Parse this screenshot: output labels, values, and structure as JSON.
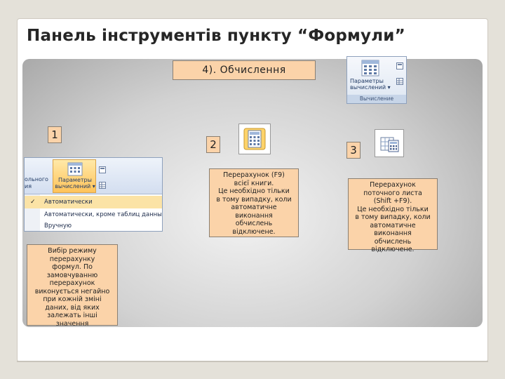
{
  "slide": {
    "title": "Панель інструментів пункту “Формули”",
    "subtitle": "4). Обчислення",
    "numbers": [
      "1",
      "2",
      "3"
    ]
  },
  "calc_group": {
    "button_label_1": "Параметры",
    "button_label_2": "вычислений",
    "group_name": "Вычисление"
  },
  "options_menu": {
    "ribbon_left_1": "ольного",
    "ribbon_left_2": "ия",
    "button_label_1": "Параметры",
    "button_label_2": "вычислений",
    "items": [
      {
        "label": "Автоматически",
        "checked": true
      },
      {
        "label": "Автоматически, кроме таблиц данных",
        "checked": false
      },
      {
        "label": "Вручную",
        "checked": false
      }
    ]
  },
  "notes": {
    "note1": "Вибір режиму\nперерахунку\nформул. По\nзамовчуванню\nперерахунок\nвиконується негайно\nпри кожній зміні\nданих, від яких\nзалежать інші\nзначення",
    "note2": "Перерахунок (F9)\nвсієї книги.\nЦе необхідно тільки\nв тому випадку, коли\nавтоматичне\nвиконання\nобчислень\nвідключене.",
    "note3": "Перерахунок\nпоточного листа\n(Shift +F9).\nЦе необхідно тільки\nв тому випадку, коли\nавтоматичне\nвиконання\nобчислень\nвідключене."
  },
  "icons": {
    "calc_now": "calculator-icon",
    "calc_sheet": "sheet-calculator-icon"
  },
  "colors": {
    "label_fill": "#fbd3a9",
    "title": "#262626",
    "ribbon_blue": "#233c66"
  }
}
